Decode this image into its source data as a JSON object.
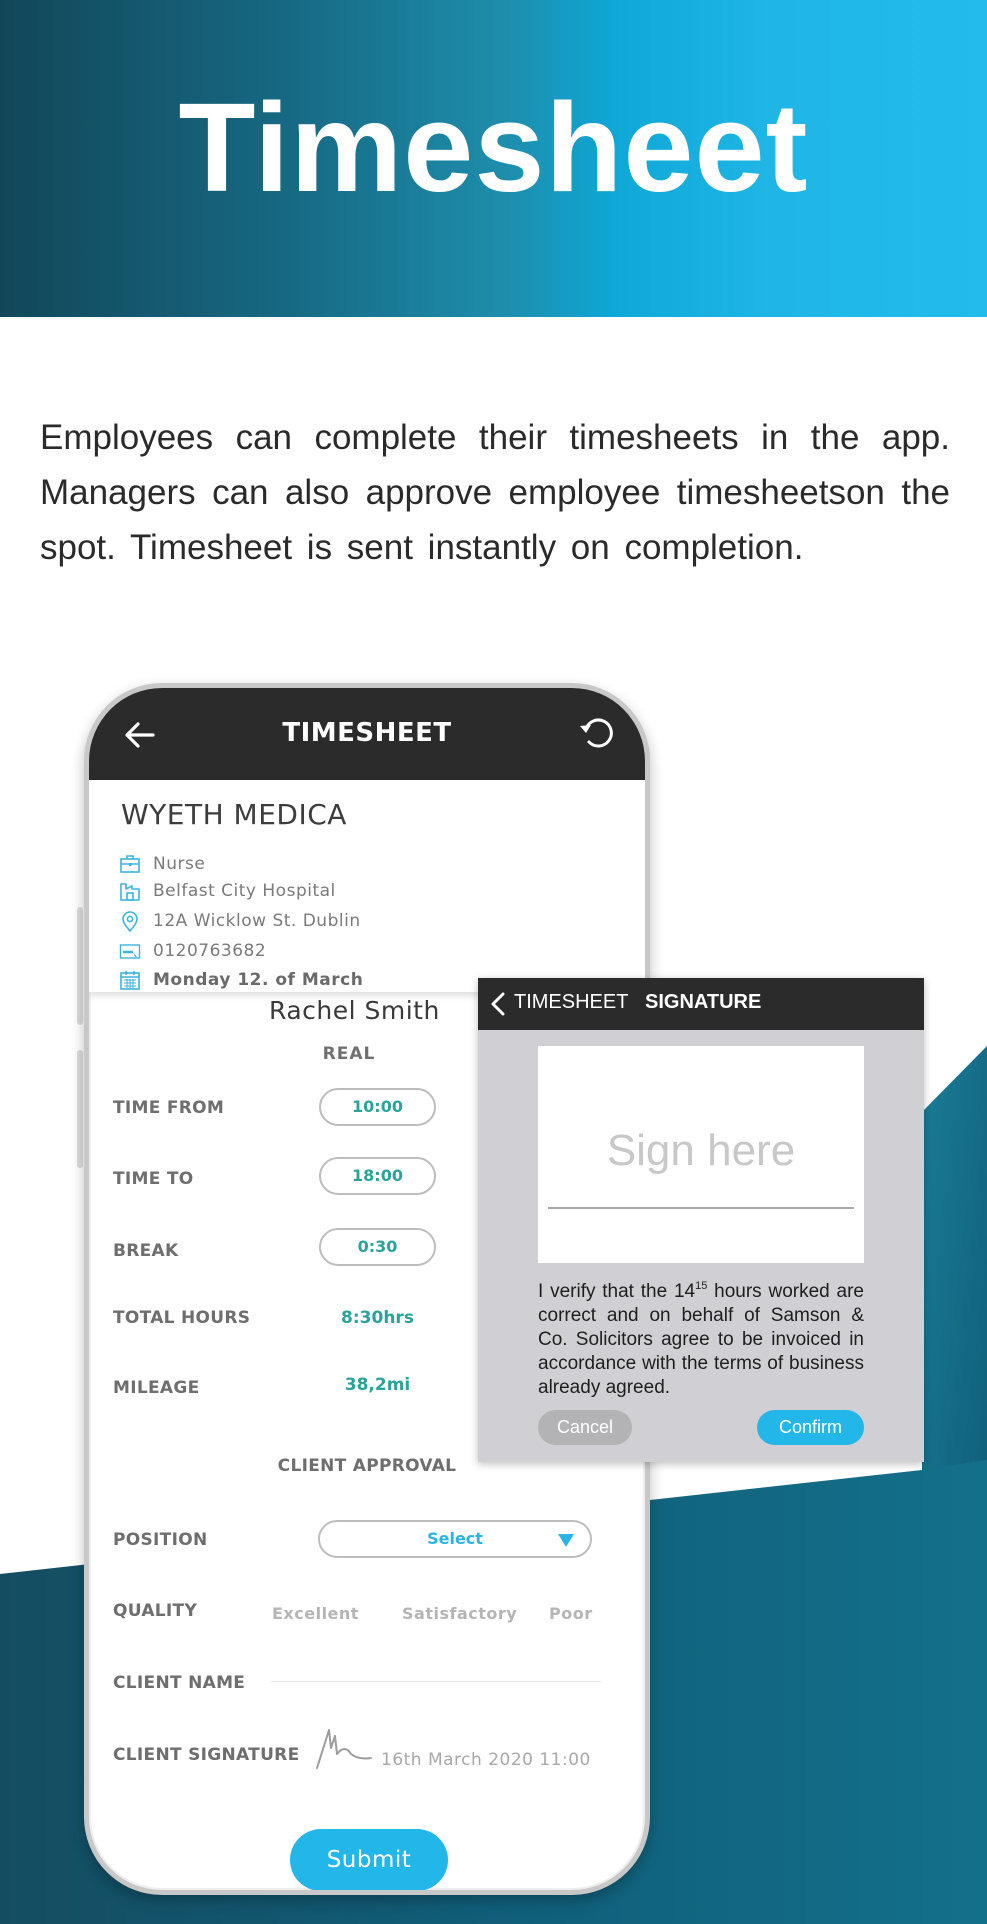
{
  "banner": {
    "title": "Timesheet"
  },
  "intro": {
    "text": "Employees can complete their timesheets in the app. Managers can also approve employee timesheetson the spot. Timesheet is sent instantly on completion."
  },
  "colors": {
    "accent_blue": "#22b6e9",
    "value_teal": "#2aa39a",
    "header_dark": "#2b2b2b",
    "banner_dark": "#124759",
    "banner_light": "#22bbea",
    "bg_teal": "#156a84"
  },
  "phone": {
    "header": {
      "title": "TIMESHEET",
      "back_icon": "arrow-left-icon",
      "refresh_icon": "refresh-icon"
    },
    "info": {
      "company": "WYETH MEDICA",
      "rows": [
        {
          "icon": "briefcase-icon",
          "text": "Nurse"
        },
        {
          "icon": "building-icon",
          "text": "Belfast City Hospital"
        },
        {
          "icon": "location-pin-icon",
          "text": "12A Wicklow  St. Dublin"
        },
        {
          "icon": "book-icon",
          "text": "0120763682"
        },
        {
          "icon": "calendar-icon",
          "text": "Monday 12. of March"
        }
      ]
    },
    "employee_name": "Rachel Smith",
    "column_header": "REAL",
    "fields": {
      "time_from": {
        "label": "TIME FROM",
        "value": "10:00"
      },
      "time_to": {
        "label": "TIME TO",
        "value": "18:00"
      },
      "break": {
        "label": "BREAK",
        "value": "0:30"
      },
      "total_hours": {
        "label": "TOTAL HOURS",
        "value": "8:30hrs"
      },
      "mileage": {
        "label": "MILEAGE",
        "value": "38,2mi"
      }
    },
    "client_approval": {
      "title": "CLIENT APPROVAL",
      "position_label": "POSITION",
      "position_value": "Select",
      "quality_label": "QUALITY",
      "quality_options": [
        "Excellent",
        "Satisfactory",
        "Poor"
      ],
      "client_name_label": "CLIENT NAME",
      "client_name_value": "",
      "client_signature_label": "CLIENT SIGNATURE",
      "signature_date": "16th March 2020 11:00"
    },
    "submit_label": "Submit"
  },
  "signature_card": {
    "back_label": "TIMESHEET",
    "title": "SIGNATURE",
    "placeholder": "Sign here",
    "verify_prefix": "I verify that the 14",
    "verify_sup": "15",
    "verify_suffix": " hours worked are correct and on behalf of Samson & Co. Solicitors agree to be invoiced in accordance with the terms of business already agreed.",
    "cancel_label": "Cancel",
    "confirm_label": "Confirm"
  }
}
